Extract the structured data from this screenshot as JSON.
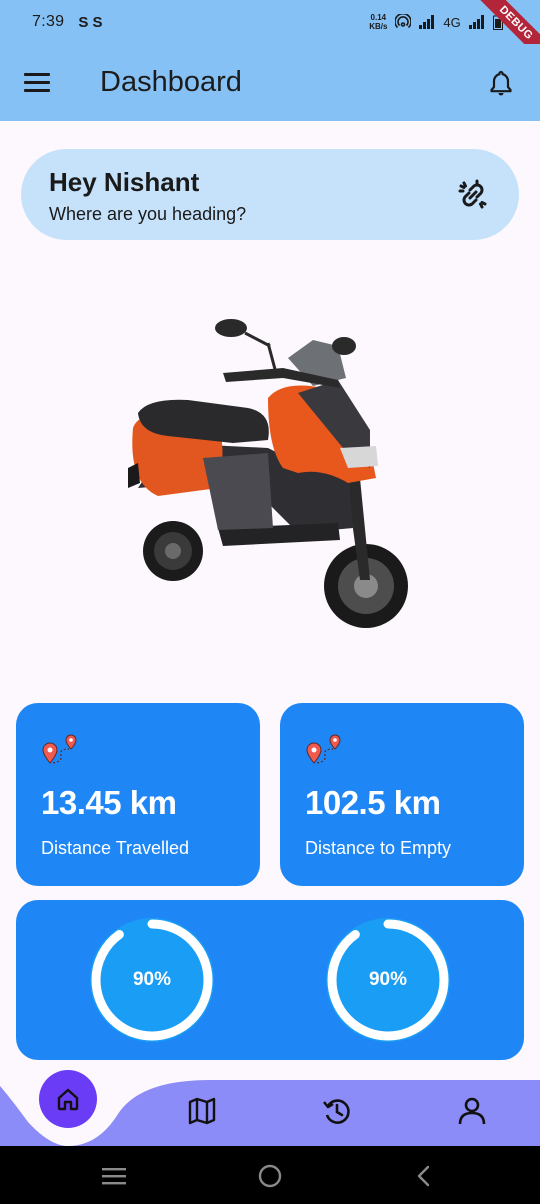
{
  "status_bar": {
    "time": "7:39",
    "notif_icons": "S S",
    "net_speed_value": "0.14",
    "net_speed_unit": "KB/s",
    "network": "4G",
    "battery_partial": "7",
    "debug_label": "DEBUG"
  },
  "app_bar": {
    "title": "Dashboard"
  },
  "greeting": {
    "name": "Hey Nishant",
    "subtitle": "Where are you heading?"
  },
  "stats": [
    {
      "value": "13.45 km",
      "label": "Distance Travelled"
    },
    {
      "value": "102.5 km",
      "label": "Distance to Empty"
    }
  ],
  "battery": [
    {
      "text": "90%",
      "level": 0.9
    },
    {
      "text": "90%",
      "level": 0.9
    }
  ],
  "bottom_nav": {
    "items": [
      "home-icon",
      "map-icon",
      "history-icon",
      "profile-icon"
    ],
    "active": "home"
  },
  "colors": {
    "app_bar": "#86c1f5",
    "greeting_card": "#c6e2fb",
    "card": "#1f87f5",
    "nav_bar": "#8c8cf8",
    "nav_active": "#6a3cf5",
    "gauge_ring": "#ffffff",
    "gauge_fill": "#1aa0f5"
  }
}
